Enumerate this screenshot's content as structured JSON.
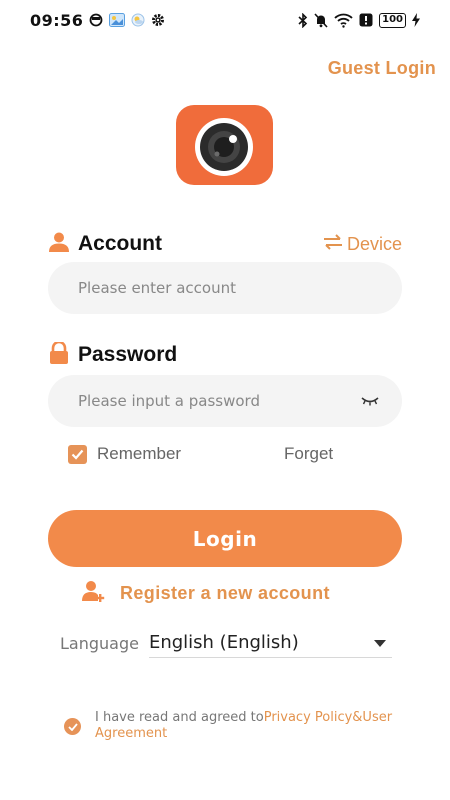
{
  "status_bar": {
    "time": "09:56",
    "battery": "100"
  },
  "header": {
    "guest_login": "Guest Login"
  },
  "account": {
    "label": "Account",
    "device_link": "Device",
    "placeholder": "Please enter account",
    "value": ""
  },
  "password": {
    "label": "Password",
    "placeholder": "Please input a password",
    "value": ""
  },
  "options": {
    "remember_label": "Remember",
    "remember_checked": true,
    "forget_label": "Forget"
  },
  "login_button": "Login",
  "register_link": "Register a new account",
  "language": {
    "label": "Language",
    "selected": "English (English)"
  },
  "agreement": {
    "prefix": "I have read and agreed to",
    "link": "Privacy Policy&User Agreement",
    "checked": true
  },
  "colors": {
    "accent": "#F28A4A",
    "link": "#E3934E",
    "logo_bg": "#F06C3B",
    "input_bg": "#F4F4F4"
  },
  "icons": {
    "account": "person-icon",
    "password": "lock-icon",
    "device": "swap-arrows-icon",
    "show_password": "eye-closed-icon",
    "register": "add-user-icon",
    "language_dropdown": "caret-down-icon"
  }
}
